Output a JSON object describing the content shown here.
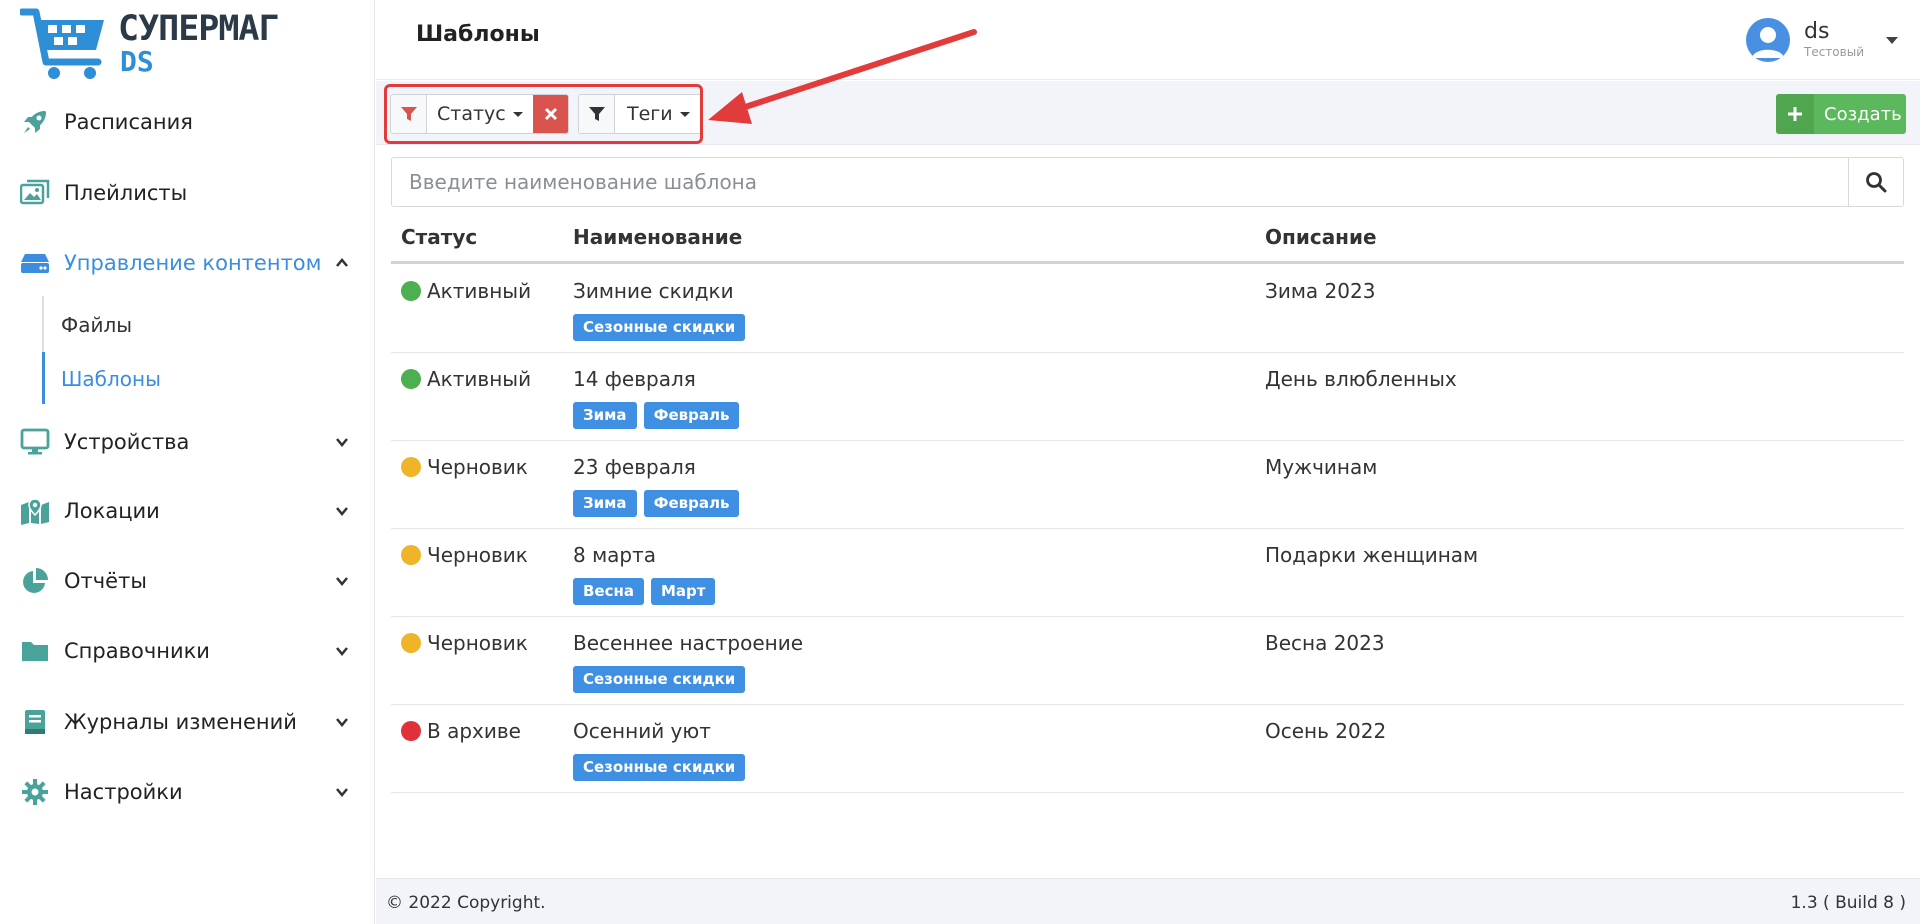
{
  "app": {
    "logo_line1": "СУПЕРМАГ",
    "logo_line2": "DS"
  },
  "sidebar": {
    "items": [
      {
        "label": "Расписания",
        "icon": "rocket-icon"
      },
      {
        "label": "Плейлисты",
        "icon": "images-icon"
      },
      {
        "label": "Управление контентом",
        "icon": "hdd-icon",
        "expanded": true
      },
      {
        "label": "Устройства",
        "icon": "monitor-icon"
      },
      {
        "label": "Локации",
        "icon": "map-marker-icon"
      },
      {
        "label": "Отчёты",
        "icon": "pie-chart-icon"
      },
      {
        "label": "Справочники",
        "icon": "folder-icon"
      },
      {
        "label": "Журналы изменений",
        "icon": "book-icon"
      },
      {
        "label": "Настройки",
        "icon": "gear-icon"
      }
    ],
    "subitems": [
      {
        "label": "Файлы"
      },
      {
        "label": "Шаблоны",
        "active": true
      }
    ]
  },
  "header": {
    "title": "Шаблоны",
    "user_name": "ds",
    "user_role": "Тестовый"
  },
  "toolbar": {
    "status_filter_label": "Статус",
    "tags_filter_label": "Теги",
    "create_label": "Создать"
  },
  "search": {
    "placeholder": "Введите наименование шаблона"
  },
  "table": {
    "headers": {
      "status": "Статус",
      "name": "Наименование",
      "description": "Описание"
    },
    "rows": [
      {
        "status": "Активный",
        "status_color": "#4caf50",
        "name": "Зимние скидки",
        "tags": [
          "Сезонные скидки"
        ],
        "description": "Зима 2023"
      },
      {
        "status": "Активный",
        "status_color": "#4caf50",
        "name": "14 февраля",
        "tags": [
          "Зима",
          "Февраль"
        ],
        "description": "День влюбленных"
      },
      {
        "status": "Черновик",
        "status_color": "#f0b429",
        "name": "23 февраля",
        "tags": [
          "Зима",
          "Февраль"
        ],
        "description": "Мужчинам"
      },
      {
        "status": "Черновик",
        "status_color": "#f0b429",
        "name": "8 марта",
        "tags": [
          "Весна",
          "Март"
        ],
        "description": "Подарки женщинам"
      },
      {
        "status": "Черновик",
        "status_color": "#f0b429",
        "name": "Весеннее настроение",
        "tags": [
          "Сезонные скидки"
        ],
        "description": "Весна 2023"
      },
      {
        "status": "В архиве",
        "status_color": "#e0303a",
        "name": "Осенний уют",
        "tags": [
          "Сезонные скидки"
        ],
        "description": "Осень 2022"
      }
    ]
  },
  "footer": {
    "copyright": "© 2022 Copyright.",
    "build": "1.3 ( Build 8 )"
  },
  "colors": {
    "accent": "#3b8de0",
    "icon_green": "#4aa39a",
    "highlight_red": "#e23b3b",
    "create_green": "#5cb85c"
  }
}
